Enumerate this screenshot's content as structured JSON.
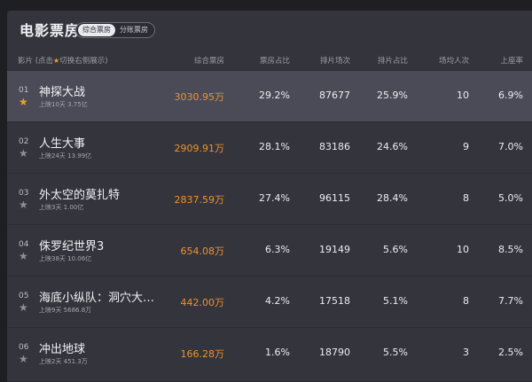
{
  "title": "电影票房",
  "toggle": {
    "active": "综合票房",
    "inactive": "分账票房"
  },
  "header": {
    "film": "影片",
    "hint_prefix": "(点击",
    "hint_suffix": "切换右侧展示)",
    "gross": "综合票房",
    "share": "票房占比",
    "shows": "排片场次",
    "show_share": "排片占比",
    "avg": "场均人次",
    "occupancy": "上座率"
  },
  "colors": {
    "accent": "#f0922a",
    "star_active": "#f0a020"
  },
  "rows": [
    {
      "rank": "01",
      "name": "神探大战",
      "sub": "上映10天  3.75亿",
      "gross": "3030.95万",
      "share": "29.2%",
      "shows": "87677",
      "show_share": "25.9%",
      "avg": "10",
      "occupancy": "6.9%",
      "starred": true
    },
    {
      "rank": "02",
      "name": "人生大事",
      "sub": "上映24天  13.99亿",
      "gross": "2909.91万",
      "share": "28.1%",
      "shows": "83186",
      "show_share": "24.6%",
      "avg": "9",
      "occupancy": "7.0%",
      "starred": false
    },
    {
      "rank": "03",
      "name": "外太空的莫扎特",
      "sub": "上映3天  1.00亿",
      "gross": "2837.59万",
      "share": "27.4%",
      "shows": "96115",
      "show_share": "28.4%",
      "avg": "8",
      "occupancy": "5.0%",
      "starred": false
    },
    {
      "rank": "04",
      "name": "侏罗纪世界3",
      "sub": "上映38天  10.06亿",
      "gross": "654.08万",
      "share": "6.3%",
      "shows": "19149",
      "show_share": "5.6%",
      "avg": "10",
      "occupancy": "8.5%",
      "starred": false
    },
    {
      "rank": "05",
      "name": "海底小纵队：洞穴大…",
      "sub": "上映9天  5686.8万",
      "gross": "442.00万",
      "share": "4.2%",
      "shows": "17518",
      "show_share": "5.1%",
      "avg": "8",
      "occupancy": "7.7%",
      "starred": false
    },
    {
      "rank": "06",
      "name": "冲出地球",
      "sub": "上映2天  451.3万",
      "gross": "166.28万",
      "share": "1.6%",
      "shows": "18790",
      "show_share": "5.5%",
      "avg": "3",
      "occupancy": "2.5%",
      "starred": false
    }
  ]
}
